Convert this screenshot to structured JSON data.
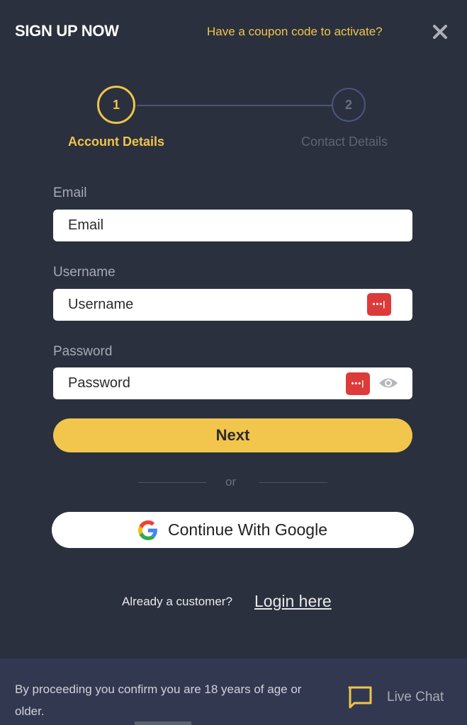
{
  "header": {
    "title": "SIGN UP NOW",
    "coupon_link": "Have a coupon code to activate?",
    "close_icon": "close-icon"
  },
  "stepper": {
    "steps": [
      {
        "number": "1",
        "label": "Account Details",
        "active": true
      },
      {
        "number": "2",
        "label": "Contact Details",
        "active": false
      }
    ]
  },
  "form": {
    "email": {
      "label": "Email",
      "placeholder": "Email",
      "value": ""
    },
    "username": {
      "label": "Username",
      "placeholder": "Username",
      "value": ""
    },
    "password": {
      "label": "Password",
      "placeholder": "Password",
      "value": ""
    },
    "next_label": "Next",
    "divider_text": "or",
    "google_label": "Continue With Google"
  },
  "login_prompt": {
    "text": "Already a customer?",
    "link": "Login here"
  },
  "footer": {
    "disclaimer": "By proceeding you confirm you are 18 years of age or older.",
    "live_chat_label": "Live Chat"
  },
  "colors": {
    "background": "#2b303e",
    "accent": "#f2c64c",
    "footer_bg": "#333851",
    "password_manager": "#dd3a3a"
  }
}
